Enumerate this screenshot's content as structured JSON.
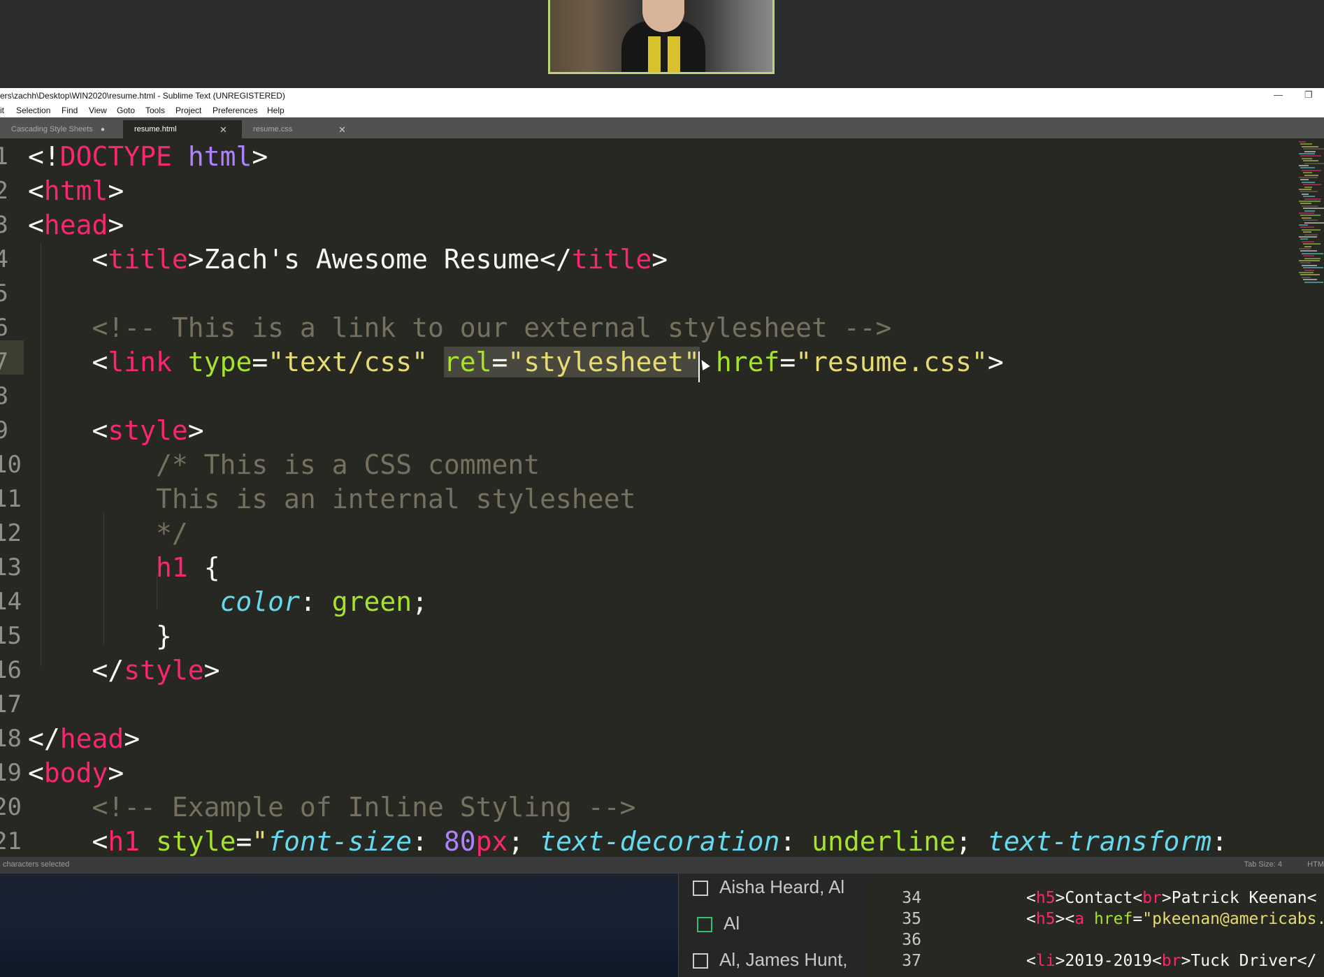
{
  "window": {
    "title": "ers\\zachh\\Desktop\\WIN2020\\resume.html - Sublime Text (UNREGISTERED)",
    "minimize_glyph": "—",
    "restore_glyph": "❐"
  },
  "menu": [
    "it",
    "Selection",
    "Find",
    "View",
    "Goto",
    "Tools",
    "Project",
    "Preferences",
    "Help"
  ],
  "tabs": [
    {
      "label": "Cascading Style Sheets",
      "close": "●"
    },
    {
      "label": "resume.html",
      "close": "✕"
    },
    {
      "label": "resume.css",
      "close": "✕"
    }
  ],
  "code_lines": [
    {
      "num": "1",
      "html": "<span class='p'>&lt;!</span><span class='t'>DOCTYPE</span> <span class='d'>html</span><span class='p'>&gt;</span>"
    },
    {
      "num": "2",
      "html": "<span class='p'>&lt;</span><span class='t'>html</span><span class='p'>&gt;</span>"
    },
    {
      "num": "3",
      "html": "<span class='p'>&lt;</span><span class='t'>head</span><span class='p'>&gt;</span>"
    },
    {
      "num": "4",
      "html": "    <span class='p'>&lt;</span><span class='t'>title</span><span class='p'>&gt;Zach's Awesome Resume&lt;/</span><span class='t'>title</span><span class='p'>&gt;</span>"
    },
    {
      "num": "5",
      "html": ""
    },
    {
      "num": "6",
      "html": "    <span class='c'>&lt;!-- This is a link to our external stylesheet --&gt;</span>"
    },
    {
      "num": "7",
      "html": "    <span class='p'>&lt;</span><span class='t'>link</span> <span class='a'>type</span><span class='p'>=</span><span class='s'>\"text/css\"</span> <span class='sel'><span class='a'>rel</span><span class='p'>=</span><span class='s'>\"stylesheet\"</span></span> <span class='a'>href</span><span class='p'>=</span><span class='s'>\"resume.css\"</span><span class='p'>&gt;</span>"
    },
    {
      "num": "8",
      "html": ""
    },
    {
      "num": "9",
      "html": "    <span class='p'>&lt;</span><span class='t'>style</span><span class='p'>&gt;</span>"
    },
    {
      "num": "10",
      "html": "        <span class='c'>/* This is a CSS comment</span>"
    },
    {
      "num": "11",
      "html": "        <span class='c'>This is an internal stylesheet</span>"
    },
    {
      "num": "12",
      "html": "        <span class='c'>*/</span>"
    },
    {
      "num": "13",
      "html": "        <span class='t'>h1</span> <span class='p'>{</span>"
    },
    {
      "num": "14",
      "html": "            <span class='prop'>color</span><span class='p'>: </span><span class='g'>green</span><span class='p'>;</span>"
    },
    {
      "num": "15",
      "html": "        <span class='p'>}</span>"
    },
    {
      "num": "16",
      "html": "    <span class='p'>&lt;/</span><span class='t'>style</span><span class='p'>&gt;</span>"
    },
    {
      "num": "17",
      "html": ""
    },
    {
      "num": "18",
      "html": "<span class='p'>&lt;/</span><span class='t'>head</span><span class='p'>&gt;</span>"
    },
    {
      "num": "19",
      "html": "<span class='p'>&lt;</span><span class='t'>body</span><span class='p'>&gt;</span>"
    },
    {
      "num": "20",
      "html": "    <span class='c'>&lt;!-- Example of Inline Styling --&gt;</span>"
    },
    {
      "num": "21",
      "html": "    <span class='p'>&lt;</span><span class='t'>h1</span> <span class='a'>style</span><span class='p'>=</span><span class='s'>\"</span><span class='prop'>font-size</span><span class='p'>: </span><span class='num'>80</span><span class='t'>px</span><span class='p'>; </span><span class='prop'>text-decoration</span><span class='p'>: </span><span class='g'>underline</span><span class='p'>; </span><span class='prop'>text-transform</span><span class='p'>:</span>"
    }
  ],
  "status": {
    "left": "characters selected",
    "tab_size": "Tab Size: 4",
    "syntax": "HTM"
  },
  "background_mail": [
    {
      "label": "Aisha Heard, Al",
      "checkbox": "unchecked"
    },
    {
      "label": "Al",
      "checkbox": "checked-green"
    },
    {
      "label": "Al, James Hunt,",
      "checkbox": "unchecked"
    }
  ],
  "background_code": [
    {
      "num": "34",
      "html": "<span class='p'>&lt;</span><span class='t'>h5</span><span class='p'>&gt;Contact&lt;</span><span class='t'>br</span><span class='p'>&gt;Patrick Keenan&lt;</span>"
    },
    {
      "num": "35",
      "html": "<span class='p'>&lt;</span><span class='t'>h5</span><span class='p'>&gt;&lt;</span><span class='t'>a</span> <span class='a'>href</span><span class='p'>=</span><span class='s'>\"pkeenan@americabs.</span>"
    },
    {
      "num": "36",
      "html": ""
    },
    {
      "num": "37",
      "html": "<span class='p'>&lt;</span><span class='t'>li</span><span class='p'>&gt;2019-2019&lt;</span><span class='t'>br</span><span class='p'>&gt;Tuck Driver&lt;/</span>"
    }
  ]
}
